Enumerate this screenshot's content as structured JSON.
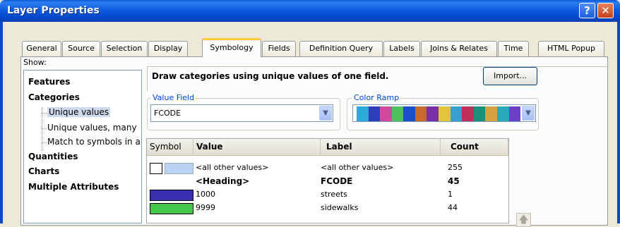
{
  "window": {
    "title": "Layer Properties",
    "help_label": "?",
    "close_label": "✕"
  },
  "tabs": [
    {
      "label": "General"
    },
    {
      "label": "Source"
    },
    {
      "label": "Selection"
    },
    {
      "label": "Display"
    },
    {
      "label": "Symbology",
      "active": true
    },
    {
      "label": "Fields"
    },
    {
      "label": "Definition Query"
    },
    {
      "label": "Labels"
    },
    {
      "label": "Joins & Relates"
    },
    {
      "label": "Time"
    },
    {
      "label": "HTML Popup"
    }
  ],
  "show": {
    "label": "Show:",
    "items": [
      {
        "label": "Features",
        "level": 0
      },
      {
        "label": "Categories",
        "level": 0
      },
      {
        "label": "Unique values",
        "level": 1,
        "selected": true
      },
      {
        "label": "Unique values, many",
        "level": 1
      },
      {
        "label": "Match to symbols in a",
        "level": 1
      },
      {
        "label": "Quantities",
        "level": 0
      },
      {
        "label": "Charts",
        "level": 0
      },
      {
        "label": "Multiple Attributes",
        "level": 0
      }
    ]
  },
  "description": "Draw categories using unique values of one field.",
  "import_label": "Import...",
  "value_field": {
    "label": "Value Field",
    "value": "FCODE"
  },
  "color_ramp": {
    "label": "Color Ramp",
    "colors": [
      "#2ea8d8",
      "#2d3fb8",
      "#d04c9a",
      "#4ec05e",
      "#1f4fc8",
      "#c86b2a",
      "#7b2fa6",
      "#e2c43a",
      "#3a9fd0",
      "#c02f5a",
      "#1d8f7e",
      "#d5a23f",
      "#2aa8b8",
      "#6b3fc8"
    ]
  },
  "table": {
    "headers": {
      "symbol": "Symbol",
      "value": "Value",
      "label": "Label",
      "count": "Count"
    },
    "rows": [
      {
        "value": "<all other values>",
        "label": "<all other values>",
        "count": "255",
        "color": "#b8d3f4",
        "bold": false,
        "checkbox": true
      },
      {
        "value": "<Heading>",
        "label": "FCODE",
        "count": "45",
        "color": null,
        "bold": true
      },
      {
        "value": "1000",
        "label": "streets",
        "count": "1",
        "color": "#3a2fb0",
        "bold": false
      },
      {
        "value": "9999",
        "label": "sidewalks",
        "count": "44",
        "color": "#48c84b",
        "bold": false
      }
    ]
  },
  "scroll_up_glyph": "🡅"
}
